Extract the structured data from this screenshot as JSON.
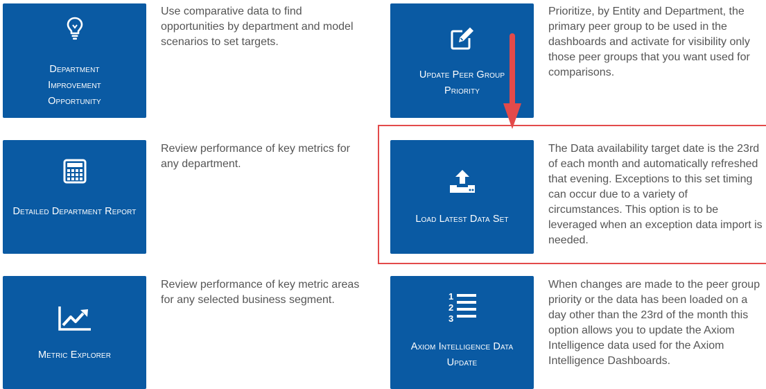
{
  "tiles": [
    {
      "id": "department-improvement-opportunity",
      "label": "Department Improvement Opportunity",
      "icon": "lightbulb-icon",
      "description": "Use comparative data to find opportunities by department and model scenarios to set targets."
    },
    {
      "id": "update-peer-group-priority",
      "label": "Update Peer Group Priority",
      "icon": "edit-icon",
      "description": "Prioritize, by Entity and Department, the primary peer group to be used in the dashboards and activate for visibility only those peer groups that you want used for comparisons."
    },
    {
      "id": "detailed-department-report",
      "label": "Detailed Department Report",
      "icon": "calculator-icon",
      "description": "Review performance of key metrics for any department."
    },
    {
      "id": "load-latest-data-set",
      "label": "Load Latest Data Set",
      "icon": "upload-icon",
      "description": "The Data availability target date is the 23rd of each month and automatically refreshed that evening. Exceptions to this set timing can occur due to a variety of circumstances. This option is to be leveraged when an exception data import is needed."
    },
    {
      "id": "metric-explorer",
      "label": "Metric Explorer",
      "icon": "trend-chart-icon",
      "description": "Review performance of key metric areas for any selected business segment."
    },
    {
      "id": "axiom-intelligence-data-update",
      "label": "Axiom Intelligence Data Update",
      "icon": "numbered-list-icon",
      "description": "When changes are made to the peer group priority or the data has been loaded on a day other than the 23rd of the month this option allows you to update the Axiom Intelligence data used for the Axiom Intelligence Dashboards."
    }
  ],
  "annotation": {
    "arrow_icon": "down-arrow-icon",
    "highlight_color": "#e34a4a"
  },
  "colors": {
    "tile": "#0a5aa3",
    "description_text": "#555555"
  }
}
